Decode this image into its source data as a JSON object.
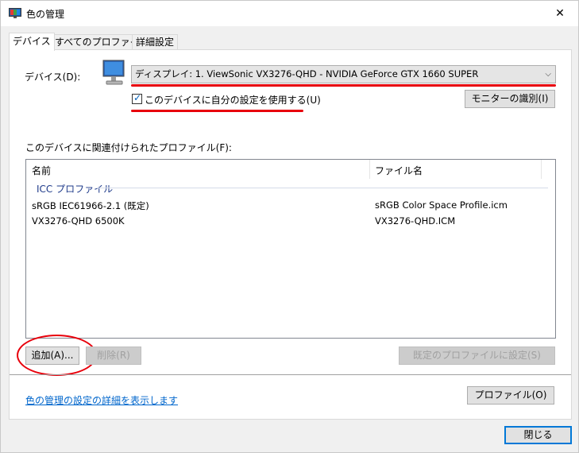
{
  "window": {
    "title": "色の管理",
    "close_glyph": "✕"
  },
  "tabs": [
    {
      "label": "デバイス",
      "active": true
    },
    {
      "label": "すべてのプロファイル",
      "active": false
    },
    {
      "label": "詳細設定",
      "active": false
    }
  ],
  "device": {
    "label": "デバイス(D):",
    "selected": "ディスプレイ: 1. ViewSonic VX3276-QHD - NVIDIA GeForce GTX 1660 SUPER",
    "dropdown_glyph": "⌵",
    "use_my_settings_label": "このデバイスに自分の設定を使用する(U)",
    "use_my_settings_checked": true,
    "check_glyph": "✓",
    "identify_button": "モニターの識別(I)"
  },
  "profiles": {
    "label": "このデバイスに関連付けられたプロファイル(F):",
    "columns": [
      "名前",
      "ファイル名"
    ],
    "group_title": "ICC プロファイル",
    "rows": [
      {
        "name": "sRGB IEC61966-2.1 (既定)",
        "file": "sRGB Color Space Profile.icm"
      },
      {
        "name": "VX3276-QHD 6500K",
        "file": "VX3276-QHD.ICM"
      }
    ]
  },
  "buttons": {
    "add": "追加(A)...",
    "remove": "削除(R)",
    "set_default": "既定のプロファイルに設定(S)",
    "profile": "プロファイル(O)",
    "close": "閉じる"
  },
  "footer": {
    "link": "色の管理の設定の詳細を表示します"
  },
  "colors": {
    "annotation_red": "#e8000b",
    "accent_blue": "#0078d7",
    "link_blue": "#0066cc"
  }
}
